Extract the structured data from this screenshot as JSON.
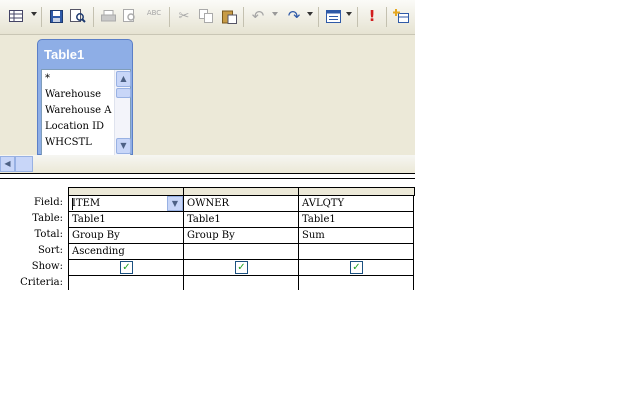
{
  "toolbar": {
    "icons": [
      "view-icon",
      "save-icon",
      "find-icon",
      "print-icon",
      "print-preview-icon",
      "spelling-icon",
      "cut-icon",
      "copy-icon",
      "paste-icon",
      "undo-icon",
      "redo-icon",
      "query-type-icon",
      "run-icon",
      "show-table-icon"
    ],
    "spelling_label": "ABC",
    "run_label": "!"
  },
  "table_box": {
    "title": "Table1",
    "fields": [
      "*",
      "Warehouse",
      "Warehouse A",
      "Location ID",
      "WHCSTL"
    ]
  },
  "grid": {
    "row_labels": [
      "Field:",
      "Table:",
      "Total:",
      "Sort:",
      "Show:",
      "Criteria:"
    ],
    "columns": [
      {
        "field": "ITEM",
        "table": "Table1",
        "total": "Group By",
        "sort": "Ascending",
        "show": true
      },
      {
        "field": "OWNER",
        "table": "Table1",
        "total": "Group By",
        "sort": "",
        "show": true
      },
      {
        "field": "AVLQTY",
        "table": "Table1",
        "total": "Sum",
        "sort": "",
        "show": true
      }
    ]
  },
  "colors": {
    "title_bar": "#8eaee6",
    "check": "#21a121",
    "background": "#ece9d8"
  }
}
